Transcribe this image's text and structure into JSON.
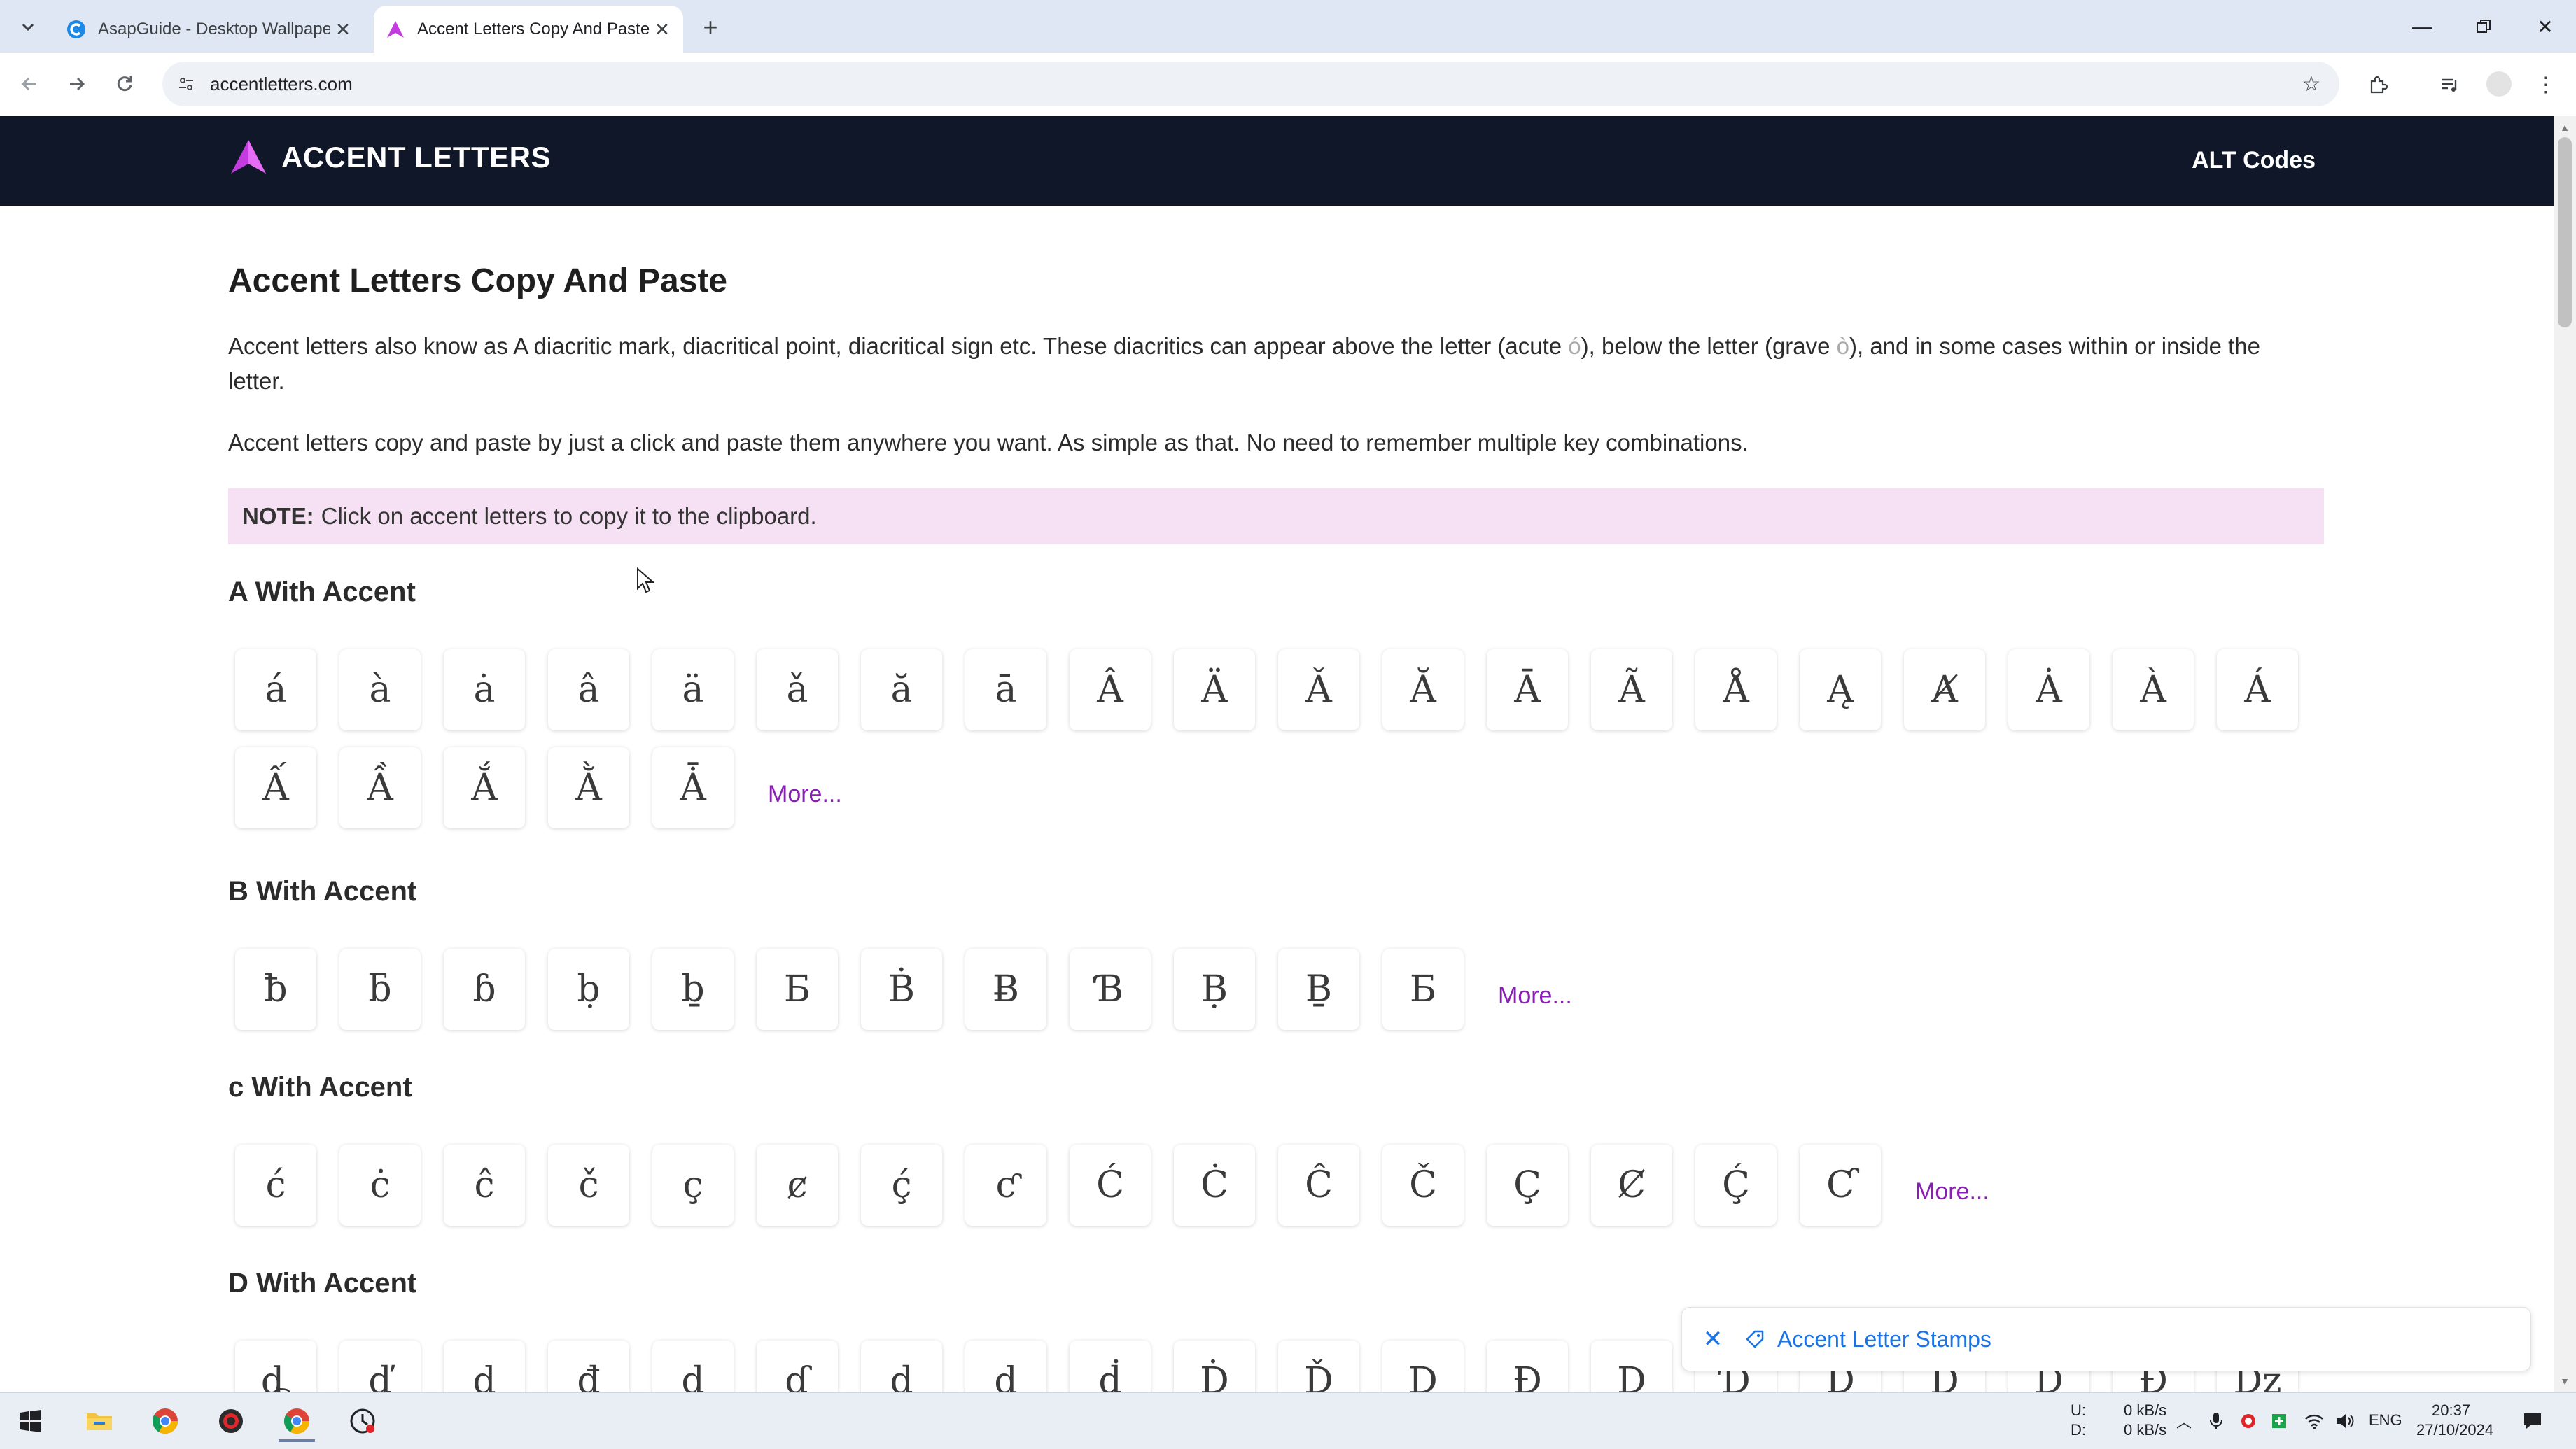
{
  "browser": {
    "tabs": [
      {
        "title": "AsapGuide - Desktop Wallpape",
        "active": false
      },
      {
        "title": "Accent Letters Copy And Paste",
        "active": true
      }
    ],
    "url": "accentletters.com"
  },
  "site": {
    "logo_text": "ACCENT LETTERS",
    "nav_link": "ALT Codes"
  },
  "page": {
    "title": "Accent Letters Copy And Paste",
    "intro_1": "Accent letters also know as A diacritic mark, diacritical point, diacritical sign etc. These diacritics can appear above the letter (acute ",
    "intro_1_acute": "ó",
    "intro_1_mid": "), below the letter (grave ",
    "intro_1_grave": "ò",
    "intro_1_end": "), and in some cases within or inside the letter.",
    "intro_2": "Accent letters copy and paste by just a click and paste them anywhere you want. As simple as that. No need to remember multiple key combinations.",
    "note_label": "NOTE:",
    "note_text": "Click on accent letters to copy it to the clipboard."
  },
  "sections": [
    {
      "title": "A With Accent",
      "letters": [
        "á",
        "à",
        "ȧ",
        "â",
        "ä",
        "ǎ",
        "ă",
        "ā",
        "Â",
        "Ä",
        "Ǎ",
        "Ă",
        "Ā",
        "Ã",
        "Å",
        "Ą",
        "Ⱥ",
        "Ȧ",
        "À",
        "Á",
        "Ấ",
        "Ầ",
        "Ắ",
        "Ằ",
        "Ǡ"
      ],
      "more": "More..."
    },
    {
      "title": "B With Accent",
      "letters": [
        "ƀ",
        "ƃ",
        "ɓ",
        "ḅ",
        "ḇ",
        "Ƃ",
        "Ḃ",
        "Ƀ",
        "Ɓ",
        "Ḅ",
        "Ḇ",
        "Б"
      ],
      "more": "More..."
    },
    {
      "title": "c With Accent",
      "letters": [
        "ć",
        "ċ",
        "ĉ",
        "č",
        "ç",
        "ȼ",
        "ḉ",
        "ƈ",
        "Ć",
        "Ċ",
        "Ĉ",
        "Č",
        "Ç",
        "Ȼ",
        "Ḉ",
        "Ƈ"
      ],
      "more": "More..."
    },
    {
      "title": "D With Accent",
      "letters": [
        "ȡ",
        "ď",
        "ḍ",
        "đ",
        "ḓ",
        "ɗ",
        "ḏ",
        "ḑ",
        "ḋ",
        "Ḋ",
        "Ď",
        "Ḍ",
        "Đ",
        "Ḓ",
        "Ɗ",
        "Ḏ",
        "Ḑ",
        "Ḋ",
        "Đ",
        "Dž"
      ]
    }
  ],
  "stamp_bar": {
    "label": "Accent Letter Stamps"
  },
  "taskbar": {
    "net_up_label": "U:",
    "net_down_label": "D:",
    "net_up": "0 kB/s",
    "net_down": "0 kB/s",
    "lang": "ENG",
    "time": "20:37",
    "date": "27/10/2024"
  },
  "colors": {
    "header_bg": "#0f1729",
    "note_bg": "#f6e1f4",
    "more_link": "#8a1fb5",
    "stamp_link": "#1a73e8",
    "logo_accent": "#c43be0"
  }
}
